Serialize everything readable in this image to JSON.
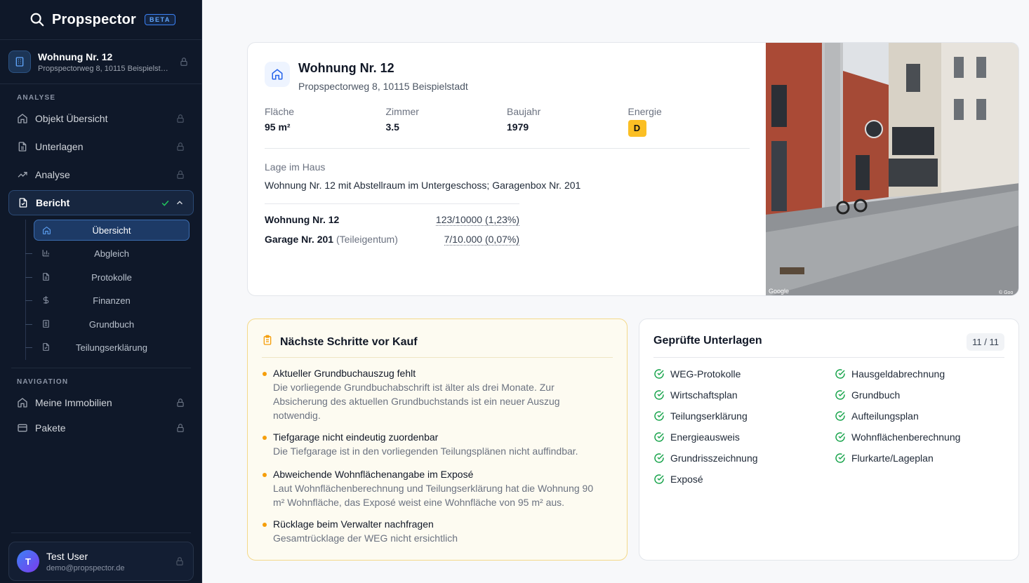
{
  "brand": {
    "name": "Propspector",
    "badge": "BETA"
  },
  "property": {
    "title": "Wohnung Nr. 12",
    "address": "Propspectorweg 8, 10115 Beispielstadt"
  },
  "sidebar": {
    "analyse_label": "ANALYSE",
    "analyse_items": [
      {
        "label": "Objekt Übersicht",
        "icon": "home-icon",
        "locked": true
      },
      {
        "label": "Unterlagen",
        "icon": "document-icon",
        "locked": true
      },
      {
        "label": "Analyse",
        "icon": "trend-icon",
        "locked": true
      },
      {
        "label": "Bericht",
        "icon": "report-icon",
        "active": true
      }
    ],
    "bericht_subitems": [
      {
        "label": "Übersicht",
        "icon": "home-icon",
        "active": true
      },
      {
        "label": "Abgleich",
        "icon": "bar-chart-icon"
      },
      {
        "label": "Protokolle",
        "icon": "document-icon"
      },
      {
        "label": "Finanzen",
        "icon": "dollar-icon"
      },
      {
        "label": "Grundbuch",
        "icon": "building-icon"
      },
      {
        "label": "Teilungserklärung",
        "icon": "file-check-icon"
      }
    ],
    "navigation_label": "NAVIGATION",
    "navigation_items": [
      {
        "label": "Meine Immobilien",
        "icon": "home-icon",
        "locked": true
      },
      {
        "label": "Pakete",
        "icon": "card-icon",
        "locked": true
      }
    ]
  },
  "user": {
    "initial": "T",
    "name": "Test User",
    "email": "demo@propspector.de"
  },
  "overview": {
    "title": "Wohnung Nr. 12",
    "address": "Propspectorweg 8, 10115 Beispielstadt",
    "facts": [
      {
        "label": "Fläche",
        "value": "95 m²"
      },
      {
        "label": "Zimmer",
        "value": "3.5"
      },
      {
        "label": "Baujahr",
        "value": "1979"
      },
      {
        "label": "Energie",
        "value": "D"
      }
    ],
    "energy_color": "#fbbf24",
    "lage_label": "Lage im Haus",
    "lage_text": "Wohnung Nr. 12 mit Abstellraum im Untergeschoss; Garagenbox Nr. 201",
    "shares": [
      {
        "name": "Wohnung Nr. 12",
        "note": "",
        "value": "123/10000 (1,23%)"
      },
      {
        "name": "Garage Nr. 201",
        "note": "(Teileigentum)",
        "value": "7/10.000 (0,07%)"
      }
    ],
    "photo_credit_left": "Google",
    "photo_credit_right": "© Goo"
  },
  "steps": {
    "title": "Nächste Schritte vor Kauf",
    "items": [
      {
        "title": "Aktueller Grundbuchauszug fehlt",
        "desc_lines": [
          "Die vorliegende Grundbuchabschrift ist älter als drei Monate. Zur",
          "Absicherung des aktuellen Grundbuchstands ist ein neuer Auszug",
          "notwendig."
        ]
      },
      {
        "title": "Tiefgarage nicht eindeutig zuordenbar",
        "desc_lines": [
          "Die Tiefgarage ist in den vorliegenden Teilungsplänen nicht auffindbar."
        ]
      },
      {
        "title": "Abweichende Wohnflächenangabe im Exposé",
        "desc_lines": [
          "Laut Wohnflächenberechnung und Teilungserklärung hat die Wohnung 90",
          "m² Wohnfläche, das Exposé weist eine Wohnfläche von 95 m² aus."
        ]
      },
      {
        "title": "Rücklage beim Verwalter nachfragen",
        "desc_lines": [
          "Gesamtrücklage der WEG nicht ersichtlich"
        ]
      }
    ]
  },
  "docs": {
    "title": "Geprüfte Unterlagen",
    "count": "11 / 11",
    "left": [
      "WEG-Protokolle",
      "Wirtschaftsplan",
      "Teilungserklärung",
      "Energieausweis",
      "Grundrisszeichnung",
      "Exposé"
    ],
    "right": [
      "Hausgeldabrechnung",
      "Grundbuch",
      "Aufteilungsplan",
      "Wohnflächenberechnung",
      "Flurkarte/Lageplan"
    ],
    "check_color": "#16a34a"
  }
}
